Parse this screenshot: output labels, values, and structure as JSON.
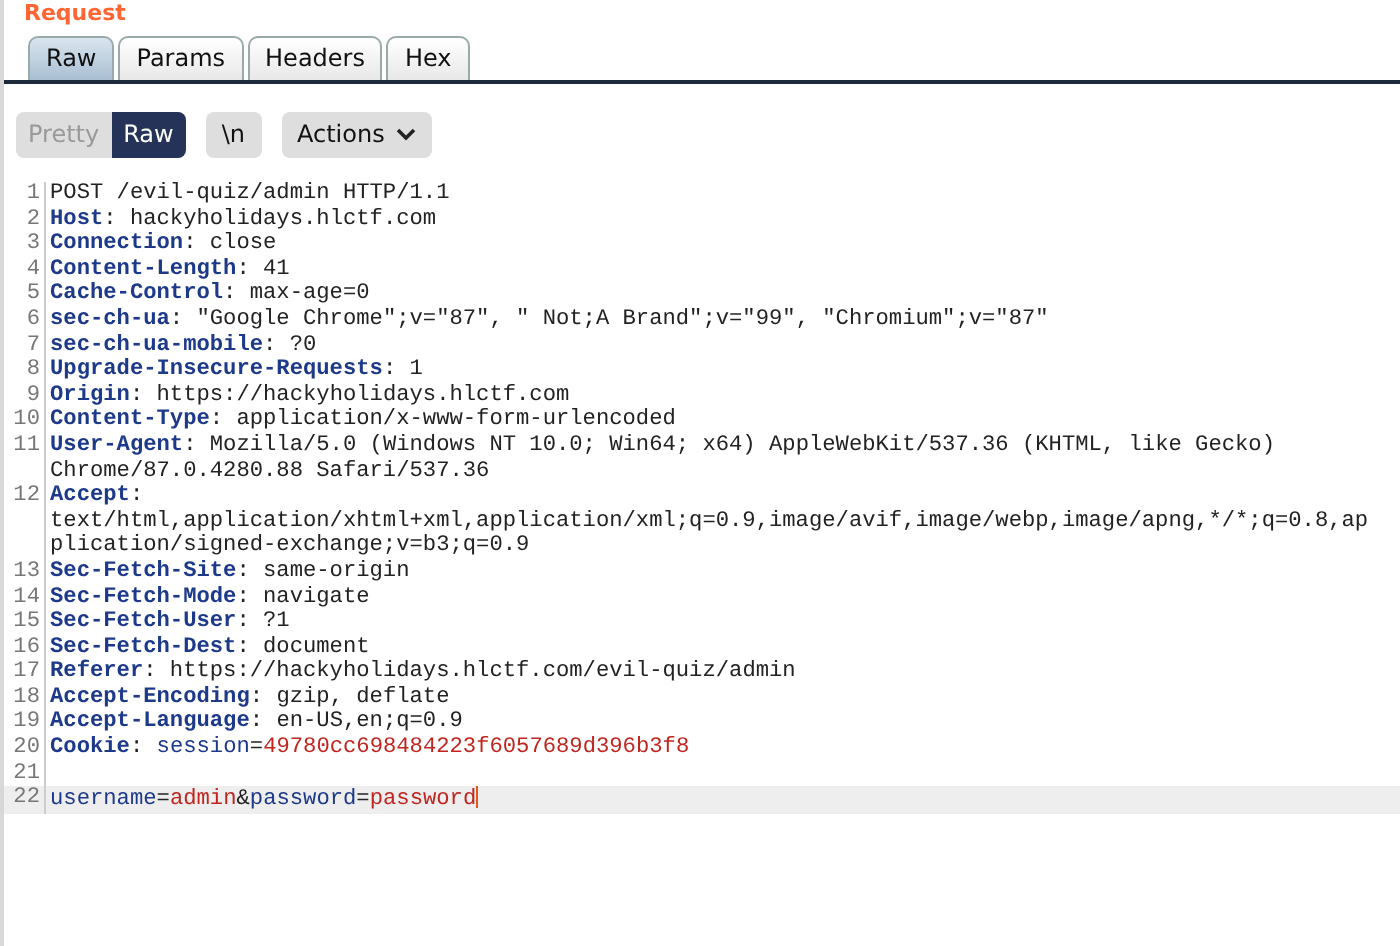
{
  "title": "Request",
  "tabs": [
    {
      "label": "Raw",
      "selected": true
    },
    {
      "label": "Params",
      "selected": false
    },
    {
      "label": "Headers",
      "selected": false
    },
    {
      "label": "Hex",
      "selected": false
    }
  ],
  "view_modes": [
    {
      "label": "Pretty",
      "selected": false
    },
    {
      "label": "Raw",
      "selected": true
    }
  ],
  "newline_button": {
    "label": "\\n"
  },
  "actions_button": {
    "label": "Actions"
  },
  "lines": [
    {
      "number": "1",
      "current": false,
      "rows": [
        [
          {
            "kind": "text",
            "text": "POST /evil-quiz/admin HTTP/1.1"
          }
        ]
      ]
    },
    {
      "number": "2",
      "current": false,
      "rows": [
        [
          {
            "kind": "header",
            "text": "Host"
          },
          {
            "kind": "text",
            "text": ": hackyholidays.hlctf.com"
          }
        ]
      ]
    },
    {
      "number": "3",
      "current": false,
      "rows": [
        [
          {
            "kind": "header",
            "text": "Connection"
          },
          {
            "kind": "text",
            "text": ": close"
          }
        ]
      ]
    },
    {
      "number": "4",
      "current": false,
      "rows": [
        [
          {
            "kind": "header",
            "text": "Content-Length"
          },
          {
            "kind": "text",
            "text": ": 41"
          }
        ]
      ]
    },
    {
      "number": "5",
      "current": false,
      "rows": [
        [
          {
            "kind": "header",
            "text": "Cache-Control"
          },
          {
            "kind": "text",
            "text": ": max-age=0"
          }
        ]
      ]
    },
    {
      "number": "6",
      "current": false,
      "rows": [
        [
          {
            "kind": "header",
            "text": "sec-ch-ua"
          },
          {
            "kind": "text",
            "text": ": \"Google Chrome\";v=\"87\", \" Not;A Brand\";v=\"99\", \"Chromium\";v=\"87\""
          }
        ]
      ]
    },
    {
      "number": "7",
      "current": false,
      "rows": [
        [
          {
            "kind": "header",
            "text": "sec-ch-ua-mobile"
          },
          {
            "kind": "text",
            "text": ": ?0"
          }
        ]
      ]
    },
    {
      "number": "8",
      "current": false,
      "rows": [
        [
          {
            "kind": "header",
            "text": "Upgrade-Insecure-Requests"
          },
          {
            "kind": "text",
            "text": ": 1"
          }
        ]
      ]
    },
    {
      "number": "9",
      "current": false,
      "rows": [
        [
          {
            "kind": "header",
            "text": "Origin"
          },
          {
            "kind": "text",
            "text": ": https://hackyholidays.hlctf.com"
          }
        ]
      ]
    },
    {
      "number": "10",
      "current": false,
      "rows": [
        [
          {
            "kind": "header",
            "text": "Content-Type"
          },
          {
            "kind": "text",
            "text": ": application/x-www-form-urlencoded"
          }
        ]
      ]
    },
    {
      "number": "11",
      "current": false,
      "rows": [
        [
          {
            "kind": "header",
            "text": "User-Agent"
          },
          {
            "kind": "text",
            "text": ": Mozilla/5.0 (Windows NT 10.0; Win64; x64) AppleWebKit/537.36 (KHTML, like Gecko)"
          }
        ],
        [
          {
            "kind": "text",
            "text": "Chrome/87.0.4280.88 Safari/537.36"
          }
        ]
      ]
    },
    {
      "number": "12",
      "current": false,
      "rows": [
        [
          {
            "kind": "header",
            "text": "Accept"
          },
          {
            "kind": "text",
            "text": ":"
          }
        ],
        [
          {
            "kind": "text",
            "text": "text/html,application/xhtml+xml,application/xml;q=0.9,image/avif,image/webp,image/apng,*/*;q=0.8,ap"
          }
        ],
        [
          {
            "kind": "text",
            "text": "plication/signed-exchange;v=b3;q=0.9"
          }
        ]
      ]
    },
    {
      "number": "13",
      "current": false,
      "rows": [
        [
          {
            "kind": "header",
            "text": "Sec-Fetch-Site"
          },
          {
            "kind": "text",
            "text": ": same-origin"
          }
        ]
      ]
    },
    {
      "number": "14",
      "current": false,
      "rows": [
        [
          {
            "kind": "header",
            "text": "Sec-Fetch-Mode"
          },
          {
            "kind": "text",
            "text": ": navigate"
          }
        ]
      ]
    },
    {
      "number": "15",
      "current": false,
      "rows": [
        [
          {
            "kind": "header",
            "text": "Sec-Fetch-User"
          },
          {
            "kind": "text",
            "text": ": ?1"
          }
        ]
      ]
    },
    {
      "number": "16",
      "current": false,
      "rows": [
        [
          {
            "kind": "header",
            "text": "Sec-Fetch-Dest"
          },
          {
            "kind": "text",
            "text": ": document"
          }
        ]
      ]
    },
    {
      "number": "17",
      "current": false,
      "rows": [
        [
          {
            "kind": "header",
            "text": "Referer"
          },
          {
            "kind": "text",
            "text": ": https://hackyholidays.hlctf.com/evil-quiz/admin"
          }
        ]
      ]
    },
    {
      "number": "18",
      "current": false,
      "rows": [
        [
          {
            "kind": "header",
            "text": "Accept-Encoding"
          },
          {
            "kind": "text",
            "text": ": gzip, deflate"
          }
        ]
      ]
    },
    {
      "number": "19",
      "current": false,
      "rows": [
        [
          {
            "kind": "header",
            "text": "Accept-Language"
          },
          {
            "kind": "text",
            "text": ": en-US,en;q=0.9"
          }
        ]
      ]
    },
    {
      "number": "20",
      "current": false,
      "rows": [
        [
          {
            "kind": "header",
            "text": "Cookie"
          },
          {
            "kind": "text",
            "text": ": "
          },
          {
            "kind": "param-name",
            "text": "session"
          },
          {
            "kind": "text",
            "text": "="
          },
          {
            "kind": "param-value",
            "text": "49780cc698484223f6057689d396b3f8"
          }
        ]
      ]
    },
    {
      "number": "21",
      "current": false,
      "rows": [
        []
      ]
    },
    {
      "number": "22",
      "current": true,
      "rows": [
        [
          {
            "kind": "param-name",
            "text": "username"
          },
          {
            "kind": "text",
            "text": "="
          },
          {
            "kind": "param-value",
            "text": "admin"
          },
          {
            "kind": "text",
            "text": "&"
          },
          {
            "kind": "param-name",
            "text": "password"
          },
          {
            "kind": "text",
            "text": "="
          },
          {
            "kind": "param-value",
            "text": "password"
          }
        ]
      ]
    }
  ]
}
